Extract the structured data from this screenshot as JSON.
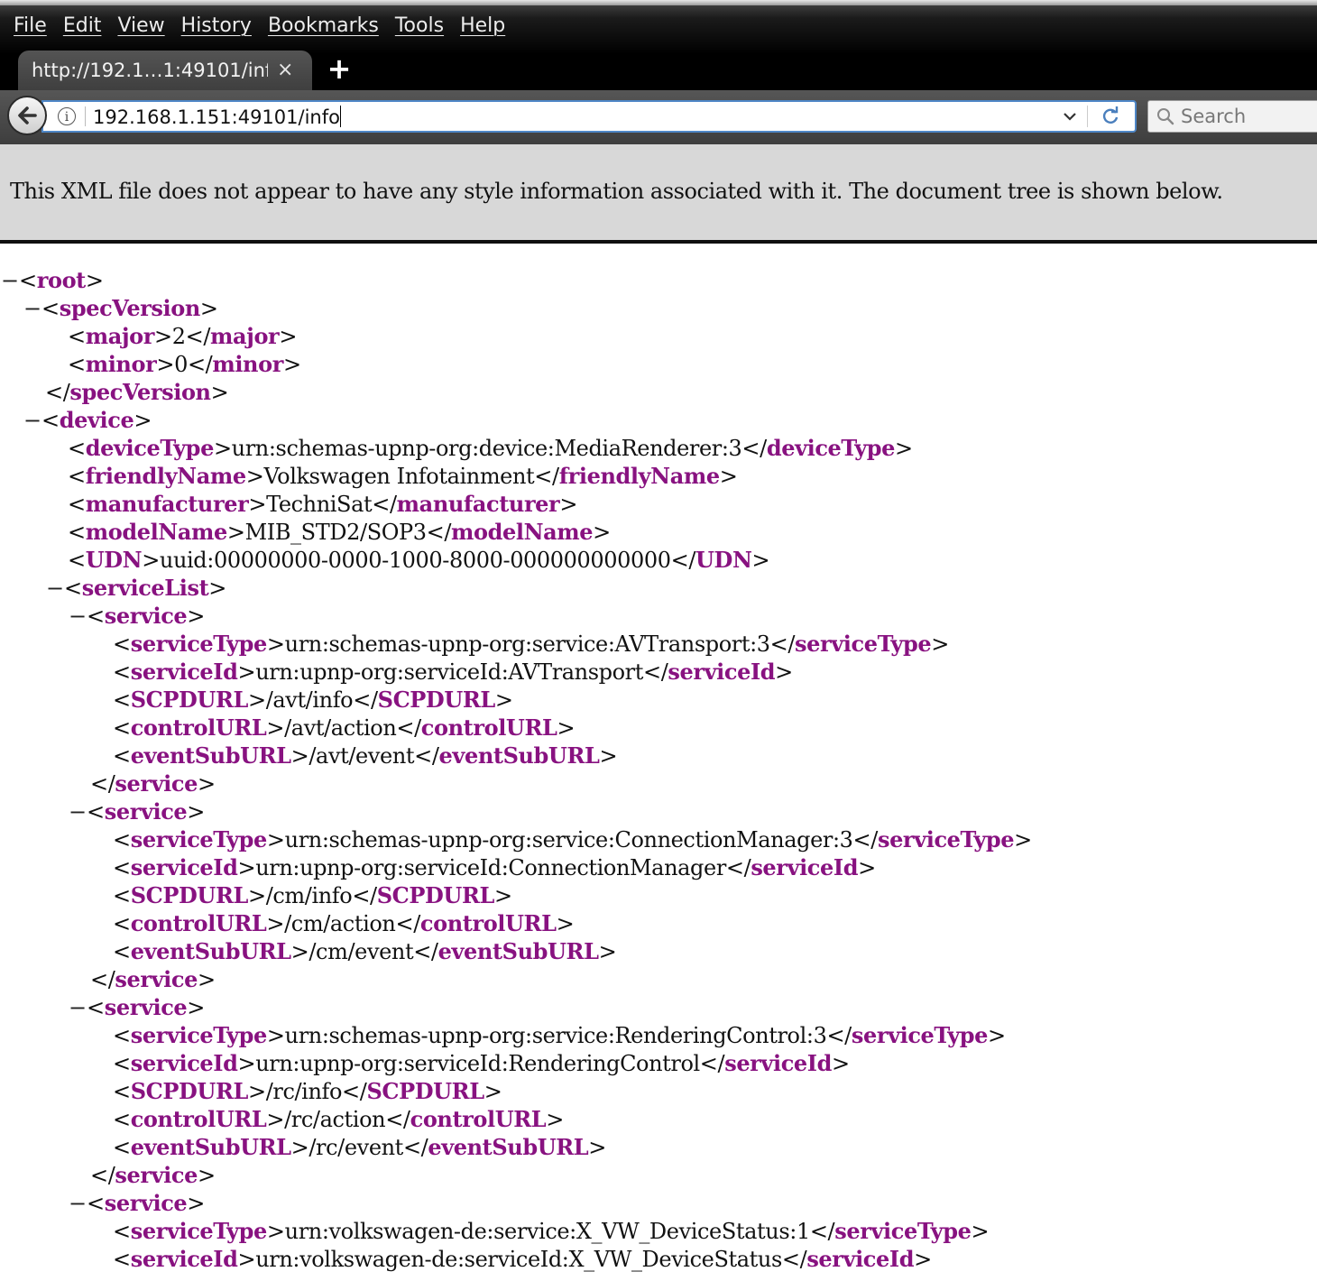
{
  "menubar": {
    "items": [
      "File",
      "Edit",
      "View",
      "History",
      "Bookmarks",
      "Tools",
      "Help"
    ]
  },
  "tab": {
    "title": "http://192.1…1:49101/info",
    "close_glyph": "×"
  },
  "new_tab_glyph": "+",
  "urlbar": {
    "url": "192.168.1.151:49101/info",
    "info_glyph": "i"
  },
  "searchbar": {
    "placeholder": "Search"
  },
  "xml_viewer": {
    "info_message": "This XML file does not appear to have any style information associated with it. The document tree is shown below.",
    "fold_glyph": "−",
    "lines": [
      {
        "depth": 0,
        "fold": true,
        "tag": "root",
        "kind": "open"
      },
      {
        "depth": 1,
        "fold": true,
        "tag": "specVersion",
        "kind": "open"
      },
      {
        "depth": 2,
        "fold": false,
        "tag": "major",
        "kind": "leaf",
        "text": "2"
      },
      {
        "depth": 2,
        "fold": false,
        "tag": "minor",
        "kind": "leaf",
        "text": "0"
      },
      {
        "depth": 1,
        "fold": false,
        "tag": "specVersion",
        "kind": "close"
      },
      {
        "depth": 1,
        "fold": true,
        "tag": "device",
        "kind": "open"
      },
      {
        "depth": 2,
        "fold": false,
        "tag": "deviceType",
        "kind": "leaf",
        "text": "urn:schemas-upnp-org:device:MediaRenderer:3"
      },
      {
        "depth": 2,
        "fold": false,
        "tag": "friendlyName",
        "kind": "leaf",
        "text": "Volkswagen Infotainment"
      },
      {
        "depth": 2,
        "fold": false,
        "tag": "manufacturer",
        "kind": "leaf",
        "text": "TechniSat"
      },
      {
        "depth": 2,
        "fold": false,
        "tag": "modelName",
        "kind": "leaf",
        "text": "MIB_STD2/SOP3"
      },
      {
        "depth": 2,
        "fold": false,
        "tag": "UDN",
        "kind": "leaf",
        "text": "uuid:00000000-0000-1000-8000-000000000000"
      },
      {
        "depth": 2,
        "fold": true,
        "tag": "serviceList",
        "kind": "open"
      },
      {
        "depth": 3,
        "fold": true,
        "tag": "service",
        "kind": "open"
      },
      {
        "depth": 4,
        "fold": false,
        "tag": "serviceType",
        "kind": "leaf",
        "text": "urn:schemas-upnp-org:service:AVTransport:3"
      },
      {
        "depth": 4,
        "fold": false,
        "tag": "serviceId",
        "kind": "leaf",
        "text": "urn:upnp-org:serviceId:AVTransport"
      },
      {
        "depth": 4,
        "fold": false,
        "tag": "SCPDURL",
        "kind": "leaf",
        "text": "/avt/info"
      },
      {
        "depth": 4,
        "fold": false,
        "tag": "controlURL",
        "kind": "leaf",
        "text": "/avt/action"
      },
      {
        "depth": 4,
        "fold": false,
        "tag": "eventSubURL",
        "kind": "leaf",
        "text": "/avt/event"
      },
      {
        "depth": 3,
        "fold": false,
        "tag": "service",
        "kind": "close"
      },
      {
        "depth": 3,
        "fold": true,
        "tag": "service",
        "kind": "open"
      },
      {
        "depth": 4,
        "fold": false,
        "tag": "serviceType",
        "kind": "leaf",
        "text": "urn:schemas-upnp-org:service:ConnectionManager:3"
      },
      {
        "depth": 4,
        "fold": false,
        "tag": "serviceId",
        "kind": "leaf",
        "text": "urn:upnp-org:serviceId:ConnectionManager"
      },
      {
        "depth": 4,
        "fold": false,
        "tag": "SCPDURL",
        "kind": "leaf",
        "text": "/cm/info"
      },
      {
        "depth": 4,
        "fold": false,
        "tag": "controlURL",
        "kind": "leaf",
        "text": "/cm/action"
      },
      {
        "depth": 4,
        "fold": false,
        "tag": "eventSubURL",
        "kind": "leaf",
        "text": "/cm/event"
      },
      {
        "depth": 3,
        "fold": false,
        "tag": "service",
        "kind": "close"
      },
      {
        "depth": 3,
        "fold": true,
        "tag": "service",
        "kind": "open"
      },
      {
        "depth": 4,
        "fold": false,
        "tag": "serviceType",
        "kind": "leaf",
        "text": "urn:schemas-upnp-org:service:RenderingControl:3"
      },
      {
        "depth": 4,
        "fold": false,
        "tag": "serviceId",
        "kind": "leaf",
        "text": "urn:upnp-org:serviceId:RenderingControl"
      },
      {
        "depth": 4,
        "fold": false,
        "tag": "SCPDURL",
        "kind": "leaf",
        "text": "/rc/info"
      },
      {
        "depth": 4,
        "fold": false,
        "tag": "controlURL",
        "kind": "leaf",
        "text": "/rc/action"
      },
      {
        "depth": 4,
        "fold": false,
        "tag": "eventSubURL",
        "kind": "leaf",
        "text": "/rc/event"
      },
      {
        "depth": 3,
        "fold": false,
        "tag": "service",
        "kind": "close"
      },
      {
        "depth": 3,
        "fold": true,
        "tag": "service",
        "kind": "open"
      },
      {
        "depth": 4,
        "fold": false,
        "tag": "serviceType",
        "kind": "leaf",
        "text": "urn:volkswagen-de:service:X_VW_DeviceStatus:1"
      },
      {
        "depth": 4,
        "fold": false,
        "tag": "serviceId",
        "kind": "leaf",
        "text": "urn:volkswagen-de:serviceId:X_VW_DeviceStatus"
      }
    ]
  },
  "colors": {
    "tag": "#881280",
    "url_focus_border": "#4f87c7",
    "info_bar_bg": "#d8d8d8"
  }
}
